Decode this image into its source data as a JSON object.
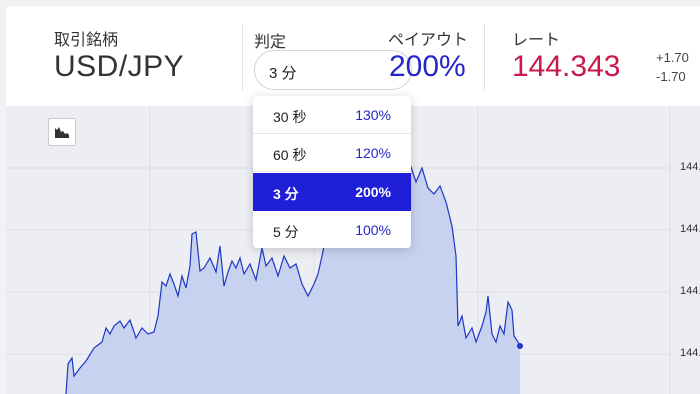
{
  "header": {
    "symbol_label": "取引銘柄",
    "symbol_value": "USD/JPY",
    "judge_label": "判定",
    "judge_value": "3 分",
    "payout_label": "ペイアウト",
    "payout_value": "200%",
    "rate_label": "レート",
    "rate_value": "144.343",
    "change_up": "+1.70",
    "change_down": "-1.70"
  },
  "dropdown": {
    "options": [
      {
        "label": "30 秒",
        "payout": "130%"
      },
      {
        "label": "60 秒",
        "payout": "120%"
      },
      {
        "label": "3 分",
        "payout": "200%"
      },
      {
        "label": "5 分",
        "payout": "100%"
      }
    ],
    "selected": "3 分"
  },
  "chart": {
    "y_ticks": [
      "144.",
      "144.",
      "144.",
      "144."
    ]
  },
  "colors": {
    "payout": "#2626c8",
    "rate": "#c8194b",
    "selected_option": "#1f1fd8",
    "area_fill": "#c7d2f0",
    "line": "#1c38c4"
  },
  "icons": {
    "chart_type": "area-chart-icon",
    "select_arrow": "none"
  }
}
